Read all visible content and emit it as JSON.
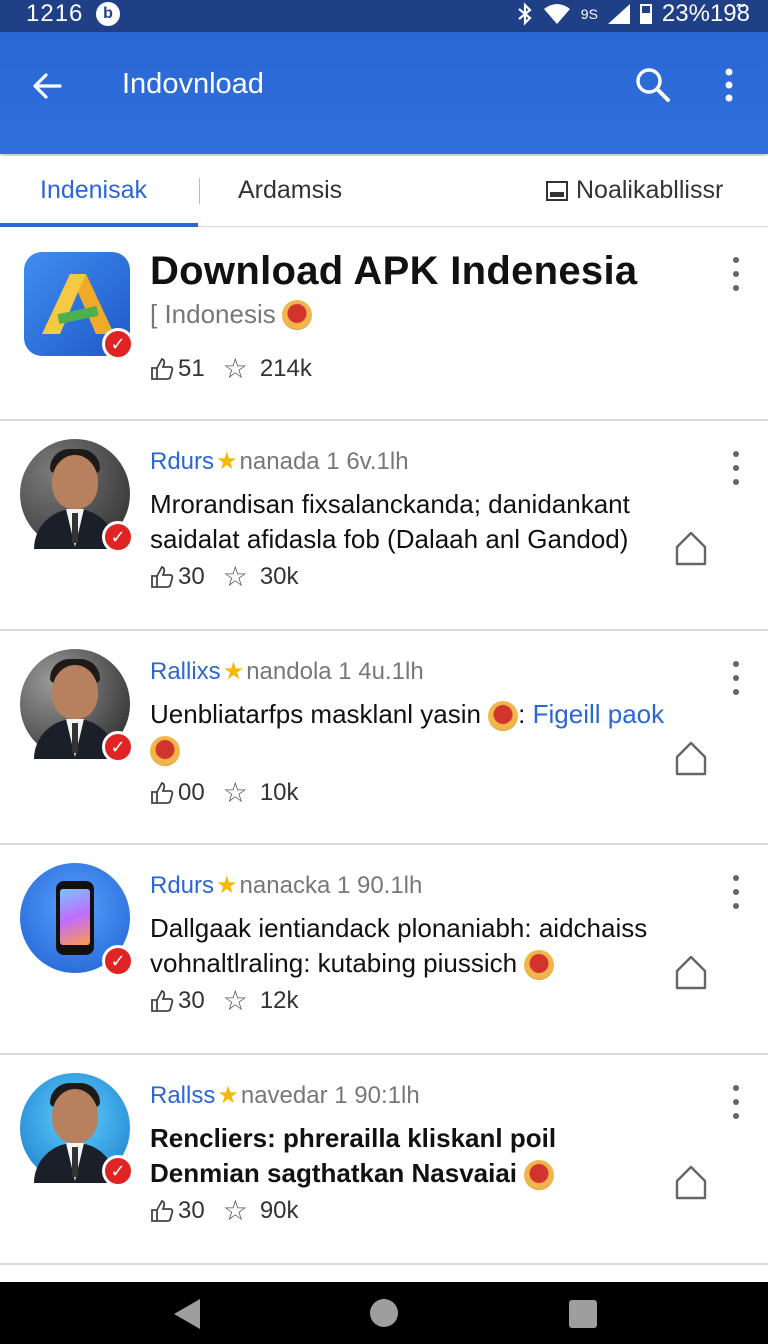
{
  "status_bar": {
    "time": "1216",
    "badge": "b",
    "network": "9S",
    "battery_time": "23%19̃8"
  },
  "app_bar": {
    "title": "Indovnload"
  },
  "tabs": [
    {
      "label": "Indenisak",
      "active": true
    },
    {
      "label": "Ardamsis",
      "active": false
    },
    {
      "label": "Noalikabllissr",
      "active": false
    }
  ],
  "header_card": {
    "title": "Download APK Indenesia",
    "subtitle": "[ Indonesis",
    "likes": "51",
    "rating": "214k"
  },
  "posts": [
    {
      "author": "Rdurs",
      "time": "nanada 1 6v.1lh",
      "text": "Mrorandisan fixsalanckanda; danidankant saidalat afidasla fob (Dalaah anl Gandod)",
      "link": "",
      "likes": "30",
      "rating": "30k"
    },
    {
      "author": "Rallixs",
      "time": "nandola 1 4u.1lh",
      "text": "Uenbliatarfps masklanl yasin",
      "link": "Figeill paok",
      "likes": "00",
      "rating": "10k"
    },
    {
      "author": "Rdurs",
      "time": "nanacka 1 90.1lh",
      "text": "Dallgaak ientiandack plonaniabh: aidchaiss vohnaltlraling: kutabing piussich",
      "link": "",
      "likes": "30",
      "rating": "12k"
    },
    {
      "author": "Rallss",
      "time": "navedar 1 90:1lh",
      "text": "Rencliers: phrerailla kliskanl poil Denmian sagthatkan Nasvaiai",
      "link": "",
      "likes": "30",
      "rating": "90k"
    }
  ],
  "icons": {
    "back": "arrow-left-icon",
    "search": "search-icon",
    "more": "more-vert-icon",
    "share": "share-icon"
  },
  "colors": {
    "primary": "#2a67d4",
    "status_bar": "#1f3f86",
    "verified": "#e02424"
  }
}
